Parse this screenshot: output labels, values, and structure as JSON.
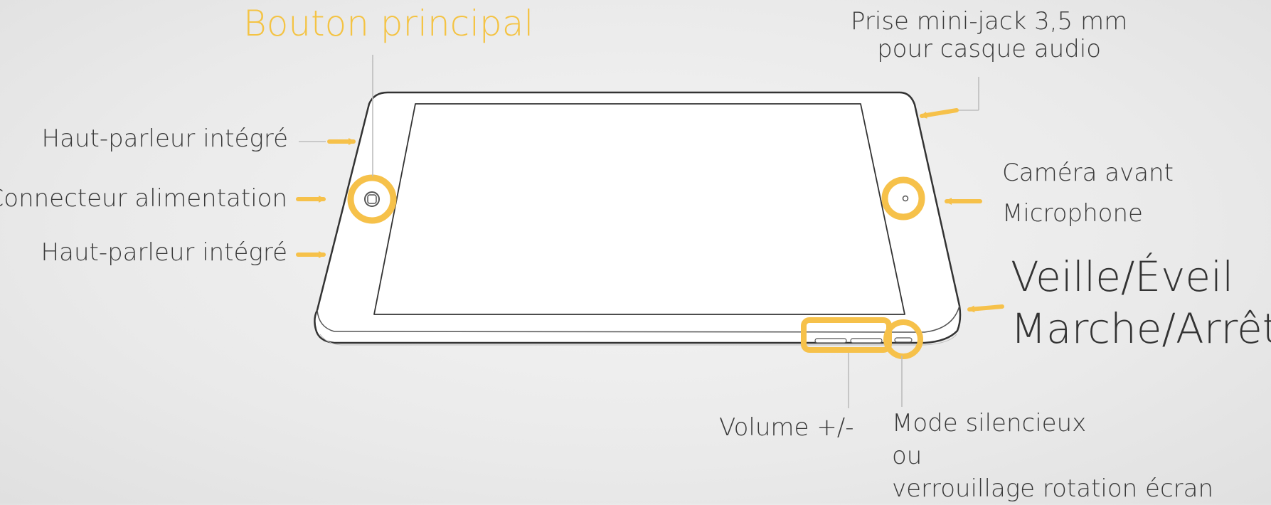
{
  "diagram": {
    "accent_color": "#f6c14a",
    "title": "Bouton principal",
    "labels": {
      "headphone_jack": "Prise mini-jack 3,5 mm\npour casque audio",
      "speaker_top": "Haut-parleur intégré",
      "power_connector": "Connecteur alimentation",
      "speaker_bottom": "Haut-parleur intégré",
      "front_camera": "Caméra avant",
      "microphone": "Microphone",
      "sleep_wake": "Veille/Éveil",
      "on_off": "Marche/Arrêt",
      "volume": "Volume +/-",
      "silent_mode": "Mode silencieux\nou\nverrouillage rotation écran"
    }
  }
}
